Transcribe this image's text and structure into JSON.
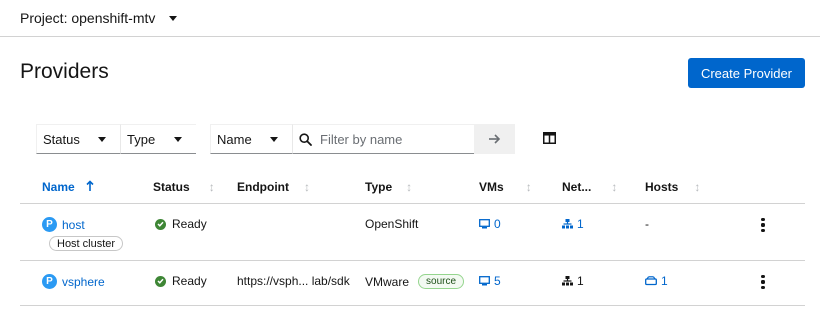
{
  "project": {
    "label": "Project: openshift-mtv"
  },
  "page": {
    "title": "Providers",
    "create_button": "Create Provider"
  },
  "toolbar": {
    "status_select": "Status",
    "type_select": "Type",
    "attribute_select": "Name",
    "search_placeholder": "Filter by name"
  },
  "table": {
    "columns": [
      "Name",
      "Status",
      "Endpoint",
      "Type",
      "VMs",
      "Net...",
      "Hosts"
    ],
    "sorted_column": "Name",
    "rows": [
      {
        "badge": "P",
        "name": "host",
        "chip": "Host cluster",
        "status": "Ready",
        "endpoint": "",
        "type": "OpenShift",
        "type_label": "",
        "vms": "0",
        "networks": "1",
        "hosts": "-"
      },
      {
        "badge": "P",
        "name": "vsphere",
        "chip": "",
        "status": "Ready",
        "endpoint": "https://vsph... lab/sdk",
        "type": "VMware",
        "type_label": "source",
        "vms": "5",
        "networks": "1",
        "hosts": "1"
      }
    ]
  },
  "colors": {
    "accent": "#0066cc",
    "success": "#3e8635",
    "badge": "#2b9af3"
  }
}
